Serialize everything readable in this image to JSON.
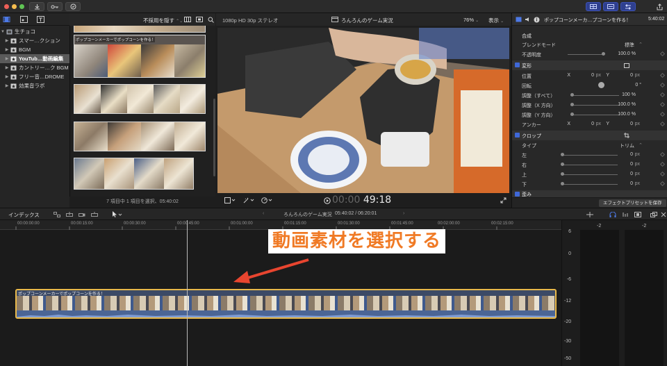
{
  "colors": {
    "accent": "#3f68d8",
    "selection": "#e9b94a",
    "annotation": "#f07a25",
    "arrow": "#e8452f"
  },
  "library": {
    "name": "生チョコ",
    "items": [
      {
        "label": "スマー…クション",
        "expanded": false
      },
      {
        "label": "BGM",
        "expanded": false
      },
      {
        "label": "YouTub…動画編集",
        "expanded": false
      },
      {
        "label": "カントリー…ク BGM",
        "expanded": false
      },
      {
        "label": "フリー音…DROME",
        "expanded": false
      },
      {
        "label": "効果音ラボ",
        "expanded": false
      }
    ]
  },
  "browser": {
    "filter": "不採用を隠す",
    "clip_title": "ポップコーンメーカーでポップコーンを作る！",
    "status": "7 項目中 1 項目を選択、05:40:02"
  },
  "viewer": {
    "format": "1080p HD 30p ステレオ",
    "project": "ろんろんのゲーム実況",
    "zoom": "76%",
    "display_menu": "表示",
    "timecode_dim": "00:00",
    "timecode": "49:18"
  },
  "inspector": {
    "title": "ポップコーンメーカ…プコーンを作る！",
    "duration": "5:40:02",
    "compositing": "合成",
    "blend_mode_label": "ブレンドモード",
    "blend_mode": "標準",
    "opacity_label": "不透明度",
    "opacity": "100.0 %",
    "transform": "変形",
    "position_label": "位置",
    "x": "X",
    "y": "Y",
    "pos_x": "0",
    "pos_y": "0",
    "unit_px": "px",
    "rotation_label": "回転",
    "rotation": "0 °",
    "scale_all_label": "調整（すべて）",
    "scale_all": "100 %",
    "scale_x_label": "調整（X 方向）",
    "scale_x": "100.0 %",
    "scale_y_label": "調整（Y 方向）",
    "scale_y": "100.0 %",
    "anchor_label": "アンカー",
    "anchor_x": "0",
    "anchor_y": "0",
    "crop": "クロップ",
    "type_label": "タイプ",
    "type_value": "トリム",
    "left_label": "左",
    "right_label": "右",
    "top_label": "上",
    "bottom_label": "下",
    "crop_left": "0",
    "crop_right": "0",
    "crop_top": "0",
    "crop_bottom": "0",
    "distort": "歪み",
    "save_preset": "エフェクトプリセットを保存"
  },
  "timeline": {
    "index_tab": "インデックス",
    "project": "ろんろんのゲーム実況",
    "position": "05:40:02 / 06:20:01",
    "ruler": [
      "00:00:00:00",
      "00:00:15:00",
      "00:00:30:00",
      "00:00:45:00",
      "00:01:00:00",
      "00:01:15:00",
      "00:01:30:00",
      "00:01:45:00",
      "00:02:00:00",
      "00:02:15:00"
    ],
    "clip_label": "ポップコーンメーカーでポップコーンを作る！"
  },
  "meter": {
    "top": [
      "-2",
      "-2"
    ],
    "scale": [
      "6",
      "0",
      "-6",
      "-12",
      "-20",
      "-30",
      "-50"
    ]
  },
  "annotation": "動画素材を選択する"
}
